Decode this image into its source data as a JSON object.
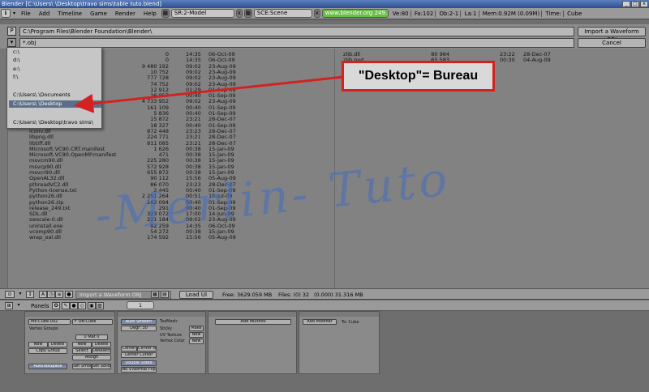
{
  "window": {
    "title": "Blender [C:\\Users\\        \\Desktop\\travo sims\\table tuto.blend]",
    "minimize": "_",
    "maximize": "□",
    "close": "x"
  },
  "infobar": {
    "menus": [
      "File",
      "Add",
      "Timeline",
      "Game",
      "Render",
      "Help"
    ],
    "screen": "SR:2-Model",
    "scene": "SCE:Scene",
    "website": "www.blender.org 249.2",
    "stats": [
      "Ve:80",
      "Fa:102",
      "Ob:2-1",
      "La:1",
      "Mem:0.92M (0.09M)",
      "Time:",
      "Cube"
    ]
  },
  "filebrowser": {
    "p_label": "P",
    "path": "C:\\Program Files\\Blender Foundation\\Blender\\",
    "filter": "*.obj",
    "import_button": "Import a Waveform OBJ",
    "cancel_button": "Cancel",
    "files": [
      {
        "name": "",
        "size": "0",
        "time": "14:35",
        "date": "06-Oct-09"
      },
      {
        "name": "",
        "size": "0",
        "time": "14:35",
        "date": "06-Oct-09"
      },
      {
        "name": "",
        "size": "9 480 192",
        "time": "09:02",
        "date": "23-Aug-09"
      },
      {
        "name": "",
        "size": "10 752",
        "time": "09:02",
        "date": "23-Aug-09"
      },
      {
        "name": "",
        "size": "777 728",
        "time": "09:02",
        "date": "23-Aug-09"
      },
      {
        "name": "",
        "size": "74 752",
        "time": "09:02",
        "date": "23-Aug-09"
      },
      {
        "name": "",
        "size": "12 912",
        "time": "01:29",
        "date": "01-Sep-09"
      },
      {
        "name": "",
        "size": "26 857",
        "time": "00:40",
        "date": "01-Sep-09"
      },
      {
        "name": "",
        "size": "4 733 952",
        "time": "09:02",
        "date": "23-Aug-09"
      },
      {
        "name": "",
        "size": "161 109",
        "time": "00:40",
        "date": "01-Sep-09"
      },
      {
        "name": "copyright.txt",
        "size": "5 836",
        "time": "00:40",
        "date": "01-Sep-09"
      },
      {
        "name": "gnu_gettext.dll",
        "size": "15 872",
        "time": "23:21",
        "date": "28-Dec-07"
      },
      {
        "name": "GPL-license.txt",
        "size": "18 327",
        "time": "00:40",
        "date": "01-Sep-09"
      },
      {
        "name": "iconv.dll",
        "size": "872 448",
        "time": "23:23",
        "date": "28-Dec-07"
      },
      {
        "name": "libpng.dll",
        "size": "224 771",
        "time": "23:21",
        "date": "28-Dec-07"
      },
      {
        "name": "libtiff.dll",
        "size": "811 085",
        "time": "23:21",
        "date": "28-Dec-07"
      },
      {
        "name": "Microsoft.VC90.CRT.manifest",
        "size": "1 626",
        "time": "00:38",
        "date": "15-Jan-09"
      },
      {
        "name": "Microsoft.VC90.OpenMP.manifest",
        "size": "471",
        "time": "00:38",
        "date": "15-Jan-09"
      },
      {
        "name": "msvcm90.dll",
        "size": "225 280",
        "time": "00:38",
        "date": "15-Jan-09"
      },
      {
        "name": "msvcp90.dll",
        "size": "572 928",
        "time": "00:38",
        "date": "15-Jan-09"
      },
      {
        "name": "msvcr90.dll",
        "size": "655 872",
        "time": "00:38",
        "date": "15-Jan-09"
      },
      {
        "name": "OpenAL32.dll",
        "size": "90 112",
        "time": "15:56",
        "date": "05-Aug-09"
      },
      {
        "name": "pthreadVC2.dll",
        "size": "86 070",
        "time": "23:23",
        "date": "28-Dec-07"
      },
      {
        "name": "Python-license.txt",
        "size": "2 445",
        "time": "00:40",
        "date": "01-Sep-09"
      },
      {
        "name": "python26.dll",
        "size": "2 251 264",
        "time": "00:51",
        "date": "15-Jul-09"
      },
      {
        "name": "python26.zip",
        "size": "162 094",
        "time": "00:40",
        "date": "01-Sep-09"
      },
      {
        "name": "release_249.txt",
        "size": "291",
        "time": "00:40",
        "date": "01-Sep-09"
      },
      {
        "name": "SDL.dll",
        "size": "323 072",
        "time": "17:00",
        "date": "14-Jun-09"
      },
      {
        "name": "swscale-0.dll",
        "size": "221 184",
        "time": "09:02",
        "date": "23-Aug-09"
      },
      {
        "name": "uninstall.exe",
        "size": "82 259",
        "time": "14:35",
        "date": "06-Oct-09"
      },
      {
        "name": "vcomp90.dll",
        "size": "54 272",
        "time": "00:38",
        "date": "15-Jan-09"
      },
      {
        "name": "wrap_oal.dll",
        "size": "174 592",
        "time": "15:56",
        "date": "05-Aug-09"
      }
    ],
    "right_files": [
      {
        "name": "zlib.dll",
        "size": "80 984",
        "time": "23:22",
        "date": "28-Dec-07"
      },
      {
        "name": "zlib.pyd",
        "size": "65 583",
        "time": "00:30",
        "date": "04-Aug-09"
      }
    ]
  },
  "drives": {
    "items": [
      "c:\\",
      "d:\\",
      "e:\\",
      "f:\\",
      "",
      "C:\\Users\\        \\Documents",
      "C:\\Users\\        \\Desktop",
      "",
      "C:\\Users\\        \\Desktop\\travo sims\\"
    ],
    "selected_index": 6
  },
  "annotation": {
    "text": "\"Desktop\"= Bureau",
    "color": "#d22222"
  },
  "watermark": {
    "text": "-Merlin-   Tuto"
  },
  "footer": {
    "import_field": "Import a Waveform OBJ",
    "load_ui": "Load UI",
    "free": "Free: 3629.059 MB",
    "files": "Files: (0) 32",
    "size": "(0.000) 31.316 MB"
  },
  "buttons_window": {
    "panels_label": "Panels",
    "frame": "1",
    "mesh_name": "ME:Cube.002",
    "object_name": "F OB:Cube",
    "vertex_groups": "Vertex Groups",
    "mat": "0 Mat 0",
    "new": "New",
    "delete": "Delete",
    "copy_group": "Copy Group",
    "select": "Select",
    "deselect": "Deselect",
    "assign": "Assign",
    "autotexspace": "AutoTexSpace",
    "set_smooth": "Set Smooth",
    "set_solid": "Set Solid",
    "auto_smooth": "Auto Smooth",
    "degr": "Degr: 30",
    "texmesh": "TexMesh:",
    "sticky": "Sticky",
    "make": "Make",
    "uv_texture": "UV Texture",
    "vertex_color": "Vertex Color",
    "new2": "New",
    "center": "Center",
    "center_new": "Center New",
    "center_cursor": "Center Cursor",
    "double_sided": "Double Sided",
    "no_vnormal_flip": "No V.Normal Flip",
    "add_multires": "Add Multires",
    "add_modifier": "Add Modifier",
    "to_cube": "To: Cube"
  }
}
